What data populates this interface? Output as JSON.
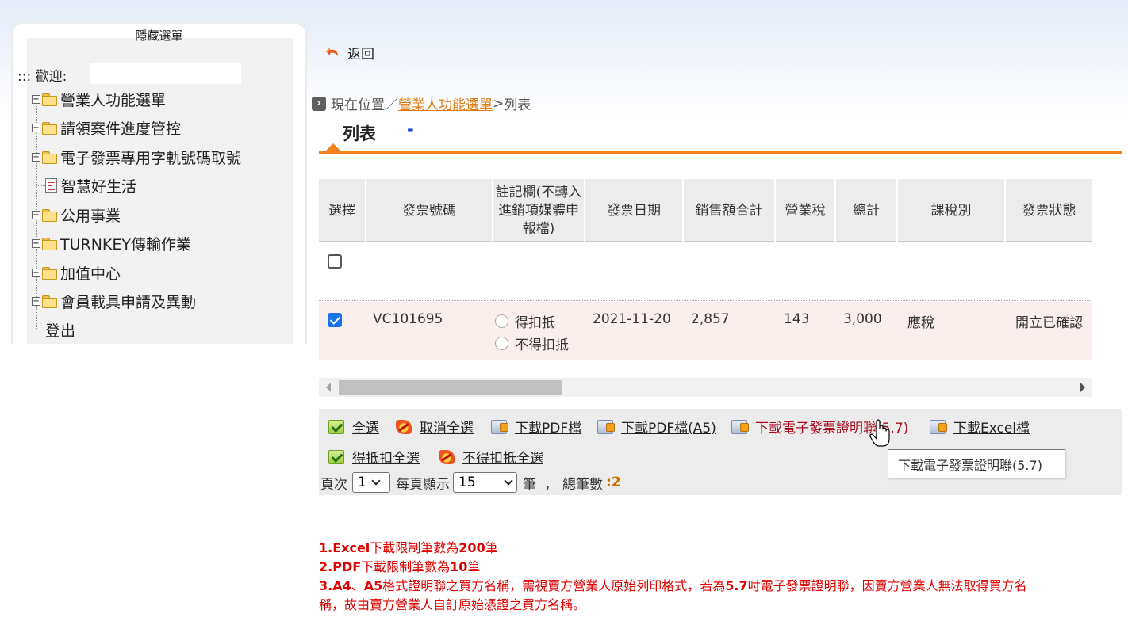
{
  "menu": {
    "title": "隱藏選單",
    "welcome_label": "::: 歡迎:",
    "items": [
      {
        "label": "營業人功能選單",
        "type": "folder"
      },
      {
        "label": "請領案件進度管控",
        "type": "folder"
      },
      {
        "label": "電子發票專用字軌號碼取號",
        "type": "folder"
      },
      {
        "label": "智慧好生活",
        "type": "document"
      },
      {
        "label": "公用事業",
        "type": "folder"
      },
      {
        "label": "TURNKEY傳輸作業",
        "type": "folder"
      },
      {
        "label": "加值中心",
        "type": "folder"
      },
      {
        "label": "會員載具申請及異動",
        "type": "folder"
      },
      {
        "label": "登出",
        "type": "link"
      }
    ]
  },
  "nav": {
    "back_label": "返回",
    "breadcrumb_prefix": "現在位置／",
    "breadcrumb_link": "營業人功能選單",
    "breadcrumb_sep": " >",
    "breadcrumb_current": "列表"
  },
  "page": {
    "title": "列表",
    "dash": "-"
  },
  "table": {
    "headers": [
      "選擇",
      "發票號碼",
      "註記欄(不轉入進銷項媒體申報檔)",
      "發票日期",
      "銷售額合計",
      "營業稅",
      "總計",
      "課稅別",
      "發票狀態"
    ],
    "header_note_lines": [
      "註記欄(不轉入",
      "進銷項媒體申",
      "報檔)"
    ],
    "rows": [
      {
        "selected": false,
        "invoice_no": "",
        "date": "",
        "sales": "",
        "tax": "",
        "total": "",
        "tax_type": "",
        "status": ""
      },
      {
        "selected": true,
        "invoice_no": "VC101695",
        "deduct_option": "得扣抵",
        "non_deduct_option": "不得扣抵",
        "date": "2021-11-20",
        "sales": "2,857",
        "tax": "143",
        "total": "3,000",
        "tax_type": "應稅",
        "status": "開立已確認"
      }
    ]
  },
  "actions": {
    "select_all": "全選",
    "cancel_all": "取消全選",
    "download_pdf": "下載PDF檔",
    "download_pdf_a5": "下載PDF檔(A5)",
    "download_einvoice": "下載電子發票證明聯(5.7)",
    "download_excel": "下載Excel檔",
    "deduct_all": "得抵扣全選",
    "non_deduct_all": "不得扣抵全選"
  },
  "pager": {
    "page_label": "頁次",
    "page_value": "1",
    "per_page_label": "每頁顯示",
    "per_page_value": "15",
    "unit_label": "筆",
    "comma": "，",
    "total_label": "總筆數",
    "total_colon": ":",
    "total_value": "2"
  },
  "tooltip": {
    "text": "下載電子發票證明聯(5.7)"
  },
  "notes": {
    "line1_bold": "1.Excel",
    "line1_rest": "下載限制筆數為",
    "line1_num": "200",
    "line1_end": "筆",
    "line2_bold": "2.PDF",
    "line2_rest": "下載限制筆數為",
    "line2_num": "10",
    "line2_end": "筆",
    "line3_a": "3.A4",
    "line3_b": "、",
    "line3_c": "A5",
    "line3_d": "格式證明聯之買方名稱，需視賣方營業人原始列印格式，若為",
    "line3_e": "5.7",
    "line3_f": "吋電子發票證明聯，因賣方營業人無法取得買方名",
    "line4": "稱，故由賣方營業人自訂原始憑證之買方名稱。"
  },
  "colors": {
    "accent_orange": "#f0821e",
    "link_orange": "#e07a11",
    "note_red": "#e00000",
    "dash_blue": "#1b3fd6",
    "selected_row_bg": "#fbefed"
  }
}
